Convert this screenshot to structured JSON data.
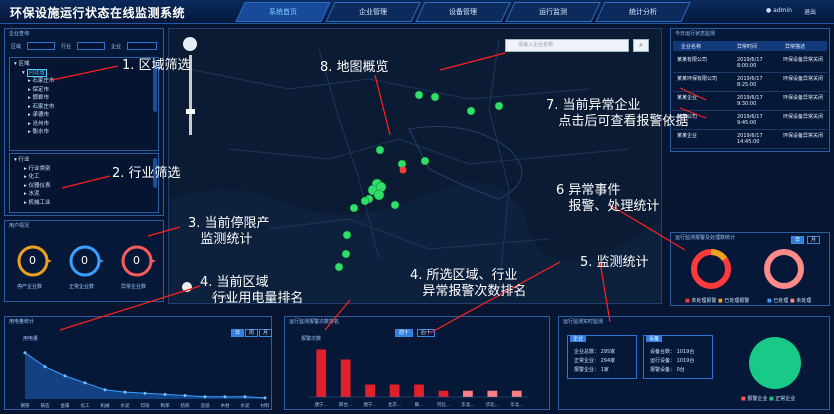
{
  "header": {
    "title": "环保设施运行状态在线监测系统",
    "nav": [
      "系统首页",
      "企业管理",
      "设备管理",
      "运行监测",
      "统计分析"
    ],
    "user": "admin",
    "exit": "退出"
  },
  "filter": {
    "title": "企业查询",
    "area_label": "区域",
    "industry_label": "行业",
    "company_label": "企业",
    "area_tree": {
      "root": "区域",
      "items": [
        "河北省",
        "石家庄市",
        "保定市",
        "邯郸市",
        "石家庄市",
        "承德市",
        "沧州市",
        "衡水市"
      ]
    },
    "industry_tree": {
      "root": "行业",
      "items": [
        "行业类别",
        "化工",
        "仪器仪表",
        "水泥",
        "机械工业"
      ]
    }
  },
  "counts": {
    "title": "用户情况",
    "circles": [
      {
        "value": "0",
        "label": "停产企业数",
        "color": "#f0a020"
      },
      {
        "value": "0",
        "label": "正常企业数",
        "color": "#3aa0ff"
      },
      {
        "value": "0",
        "label": "异常企业数",
        "color": "#ff5a5a"
      }
    ]
  },
  "map": {
    "search_placeholder": "请输入企业名称",
    "scale": "© 2019"
  },
  "alerts": {
    "title": "今日运行状态监测",
    "columns": [
      "企业名称",
      "异常时间",
      "异常描述"
    ],
    "rows": [
      [
        "某某有限公司",
        "2019/6/17 8:00:00",
        "环保设备异常关闭"
      ],
      [
        "某某环保有限公司",
        "2019/6/17 8:25:00",
        "环保设备异常关闭"
      ],
      [
        "某某企业",
        "2019/6/17 9:30:00",
        "环保设备异常关闭"
      ],
      [
        "某某公司",
        "2019/6/17 9:45:00",
        "环保设备异常关闭"
      ],
      [
        "某某企业",
        "2019/6/17 14:45:00",
        "环保设备异常关闭"
      ]
    ]
  },
  "events": {
    "title": "运行监测报警及处理数统计",
    "tabs": [
      "日",
      "月"
    ],
    "legend1": [
      "未处理报警",
      "已处理报警"
    ],
    "legend2": [
      "已处理",
      "未处理"
    ]
  },
  "electric": {
    "title": "用电量统计",
    "ylabel": "用电量",
    "tabs": [
      "日",
      "周",
      "月"
    ]
  },
  "alarm_rank": {
    "title": "运行监测报警次数排名",
    "ylabel": "报警次数",
    "toggle": [
      "前十",
      "后十"
    ]
  },
  "monitor": {
    "title": "运行监测实时监测",
    "left_tag": "企业",
    "right_tag": "设备",
    "left_rows": [
      [
        "企业总数：",
        "295家"
      ],
      [
        "正常企业：",
        "294家"
      ],
      [
        "报警企业：",
        "1家"
      ]
    ],
    "right_rows": [
      [
        "设备台数：",
        "1019台"
      ],
      [
        "运行设备：",
        "1019台"
      ],
      [
        "报警设备：",
        "0台"
      ]
    ],
    "legend": [
      "报警企业",
      "正常企业"
    ]
  },
  "annotations": [
    "1. 区域筛选",
    "2. 行业筛选",
    "3. 当前停限产\n   监测统计",
    "4. 当前区域\n   行业用电量排名",
    "4. 所选区域、行业\n   异常报警次数排名",
    "5. 监测统计",
    "6 异常事件\n   报警、处理统计",
    "7. 当前异常企业\n   点击后可查看报警依据",
    "8. 地图概览"
  ],
  "chart_data": [
    {
      "type": "area",
      "title": "用电量统计",
      "ylabel": "用电量",
      "categories": [
        "钢铁",
        "铸造",
        "金属",
        "化工",
        "机械",
        "水泥",
        "印染",
        "制革",
        "纺织",
        "造纸",
        "木材",
        "水泥",
        "材料"
      ],
      "values": [
        40,
        28,
        20,
        14,
        8,
        6,
        5,
        4,
        3,
        2,
        2,
        2,
        1
      ]
    },
    {
      "type": "bar",
      "title": "运行监测报警次数排名",
      "ylabel": "报警次数",
      "categories": [
        "唐宁...",
        "邢台...",
        "唐宁...",
        "北京...",
        "邯...",
        "河北...",
        "华北...",
        "华北...",
        "华北..."
      ],
      "values": [
        7.6,
        6,
        2,
        2,
        2,
        1,
        1,
        1,
        1
      ]
    },
    {
      "type": "pie",
      "title": "运行监测报警及处理数统计",
      "series": [
        {
          "name": "未处理报警",
          "values": [
            85
          ]
        },
        {
          "name": "已处理报警",
          "values": [
            15
          ]
        }
      ]
    },
    {
      "type": "pie",
      "title": "运行监测实时监测",
      "series": [
        {
          "name": "报警企业",
          "values": [
            1
          ]
        },
        {
          "name": "正常企业",
          "values": [
            294
          ]
        }
      ]
    }
  ]
}
